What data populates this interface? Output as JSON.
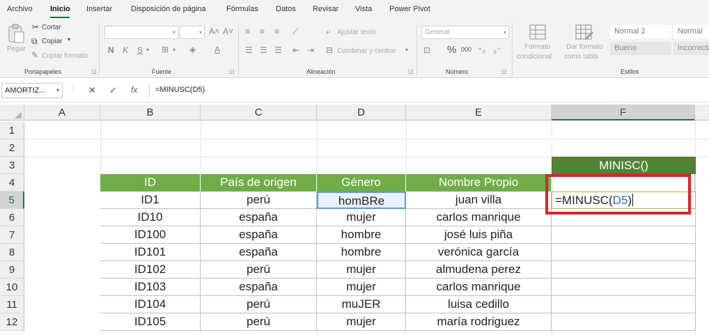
{
  "menu": {
    "tabs": [
      "Archivo",
      "Inicio",
      "Insertar",
      "Disposición de página",
      "Fórmulas",
      "Datos",
      "Revisar",
      "Vista",
      "Power Pivot"
    ],
    "active": "Inicio"
  },
  "ribbon": {
    "clipboard": {
      "paste": "Pegar",
      "cut": "Cortar",
      "copy": "Copiar",
      "format_painter": "Copiar formato",
      "group": "Portapapeles"
    },
    "font": {
      "bold": "N",
      "italic": "K",
      "underline": "S",
      "group": "Fuente"
    },
    "alignment": {
      "wrap": "Ajustar texto",
      "merge": "Combinar y centrar",
      "group": "Alineación"
    },
    "number": {
      "format": "General",
      "percent": "%",
      "thousands": "000",
      "group": "Número"
    },
    "styles": {
      "conditional_1": "Formato",
      "conditional_2": "condicional",
      "table_1": "Dar formato",
      "table_2": "como tabla",
      "normal2": "Normal 2",
      "normal": "Normal",
      "bueno": "Bueno",
      "incorrecto": "Incorrecto",
      "group": "Estilos"
    }
  },
  "formula_bar": {
    "name_box": "AMORTIZ...",
    "fx": "fx",
    "formula": "=MINUSC(D5)"
  },
  "columns": [
    "A",
    "B",
    "C",
    "D",
    "E",
    "F"
  ],
  "selected_column": "F",
  "rows": [
    "1",
    "2",
    "3",
    "4",
    "5",
    "6",
    "7",
    "8",
    "9",
    "10",
    "11",
    "12"
  ],
  "selected_row": "5",
  "f3_header": "MINISC()",
  "table": {
    "headers": [
      "ID",
      "País de origen",
      "Género",
      "Nombre Propio"
    ],
    "rows": [
      [
        "ID1",
        "perú",
        "homBRe",
        "juan villa"
      ],
      [
        "ID10",
        "españa",
        "mujer",
        "carlos manrique"
      ],
      [
        "ID100",
        "españa",
        "hombre",
        "josé luis piña"
      ],
      [
        "ID101",
        "españa",
        "hombre",
        "verónica garcía"
      ],
      [
        "ID102",
        "perú",
        "mujer",
        "almudena perez"
      ],
      [
        "ID103",
        "españa",
        "mujer",
        "carlos manrique"
      ],
      [
        "ID104",
        "perú",
        "muJER",
        "luisa cedillo"
      ],
      [
        "ID105",
        "perú",
        "mujer",
        "maría rodriguez"
      ]
    ]
  },
  "edit_cell": {
    "prefix": "=MINUSC(",
    "ref": "D5",
    "suffix": ")"
  },
  "colors": {
    "header_green": "#70ad47",
    "dark_green": "#548235",
    "highlight_red": "#e32224",
    "ref_blue": "#2f6eb4"
  }
}
